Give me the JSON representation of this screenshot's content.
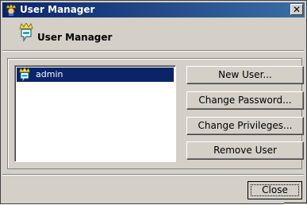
{
  "window": {
    "title": "User Manager",
    "close_glyph": "✕",
    "close_icon": "close-icon"
  },
  "header": {
    "title": "User Manager",
    "icon": "user-icon"
  },
  "users": {
    "items": [
      {
        "label": "admin",
        "icon": "user-icon",
        "selected": true
      }
    ]
  },
  "actions": {
    "new_user": "New User...",
    "change_password": "Change Password...",
    "change_privileges": "Change Privileges...",
    "remove_user": "Remove User"
  },
  "footer": {
    "close_label": "Close"
  },
  "colors": {
    "titlebar_start": "#0a246a",
    "titlebar_end": "#3a6ea5",
    "selection": "#0a246a",
    "face": "#d4d0c8"
  }
}
